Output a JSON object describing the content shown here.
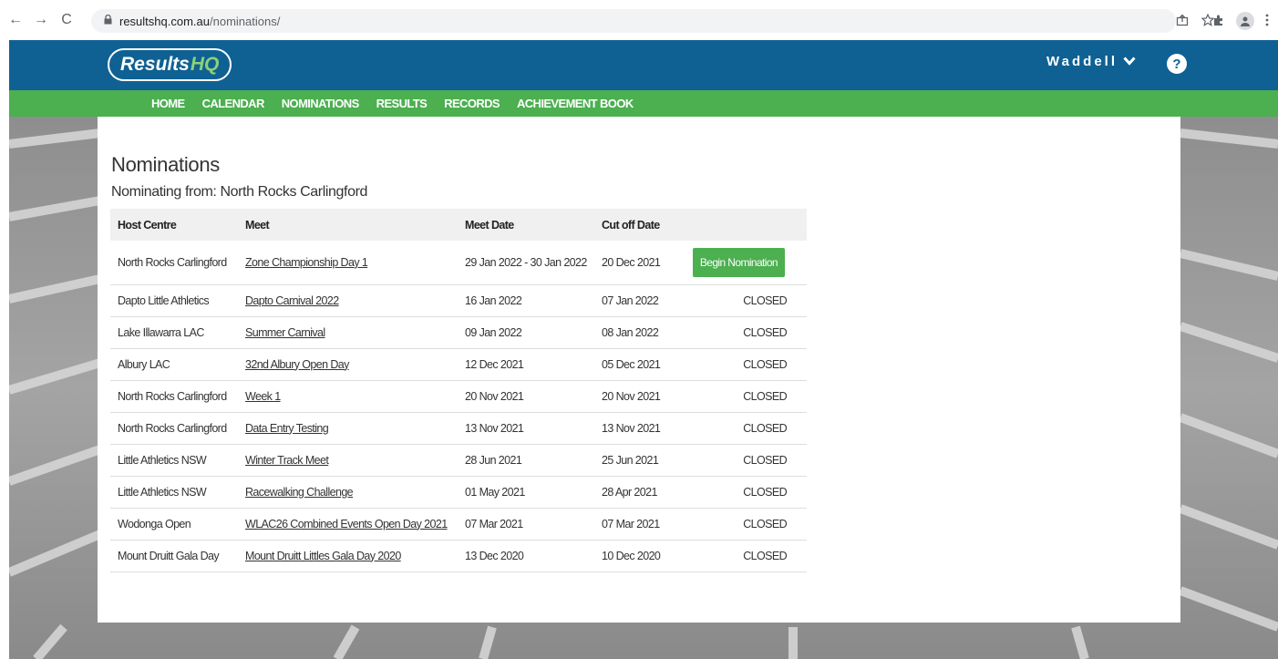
{
  "browser": {
    "url_host": "resultshq.com.au",
    "url_path": "/nominations/",
    "back": "←",
    "forward": "→",
    "reload": "C"
  },
  "header": {
    "logo_main": "Results",
    "logo_accent": "HQ",
    "user": "Waddell",
    "user_caret": "❯",
    "help": "?"
  },
  "nav": [
    "HOME",
    "CALENDAR",
    "NOMINATIONS",
    "RESULTS",
    "RECORDS",
    "ACHIEVEMENT BOOK"
  ],
  "page": {
    "title": "Nominations",
    "subtitle": "Nominating from: North Rocks Carlingford"
  },
  "table": {
    "headers": [
      "Host Centre",
      "Meet",
      "Meet Date",
      "Cut off Date",
      ""
    ],
    "rows": [
      {
        "host": "North Rocks Carlingford",
        "meet": "Zone Championship Day 1",
        "meet_date": "29 Jan 2022 - 30 Jan 2022",
        "cutoff": "20 Dec 2021",
        "status": "Begin Nomination"
      },
      {
        "host": "Dapto Little Athletics",
        "meet": "Dapto Carnival 2022",
        "meet_date": "16 Jan 2022",
        "cutoff": "07 Jan 2022",
        "status": "CLOSED"
      },
      {
        "host": "Lake Illawarra LAC",
        "meet": "Summer Carnival",
        "meet_date": "09 Jan 2022",
        "cutoff": "08 Jan 2022",
        "status": "CLOSED"
      },
      {
        "host": "Albury LAC",
        "meet": "32nd Albury Open Day",
        "meet_date": "12 Dec 2021",
        "cutoff": "05 Dec 2021",
        "status": "CLOSED"
      },
      {
        "host": "North Rocks Carlingford",
        "meet": "Week 1",
        "meet_date": "20 Nov 2021",
        "cutoff": "20 Nov 2021",
        "status": "CLOSED"
      },
      {
        "host": "North Rocks Carlingford",
        "meet": "Data Entry Testing",
        "meet_date": "13 Nov 2021",
        "cutoff": "13 Nov 2021",
        "status": "CLOSED"
      },
      {
        "host": "Little Athletics NSW",
        "meet": "Winter Track Meet",
        "meet_date": "28 Jun 2021",
        "cutoff": "25 Jun 2021",
        "status": "CLOSED"
      },
      {
        "host": "Little Athletics NSW",
        "meet": "Racewalking Challenge",
        "meet_date": "01 May 2021",
        "cutoff": "28 Apr 2021",
        "status": "CLOSED"
      },
      {
        "host": "Wodonga Open",
        "meet": "WLAC26 Combined Events Open Day 2021",
        "meet_date": "07 Mar 2021",
        "cutoff": "07 Mar 2021",
        "status": "CLOSED"
      },
      {
        "host": "Mount Druitt Gala Day",
        "meet": "Mount Druitt Littles Gala Day 2020",
        "meet_date": "13 Dec 2020",
        "cutoff": "10 Dec 2020",
        "status": "CLOSED"
      }
    ]
  },
  "colors": {
    "header_blue": "#0f6193",
    "nav_green": "#4caf50",
    "button_green": "#4caf50"
  }
}
